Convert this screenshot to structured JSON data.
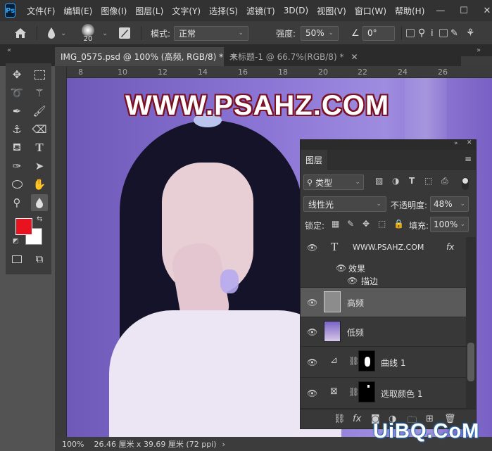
{
  "app": {
    "logo": "Ps"
  },
  "menu": [
    "文件(F)",
    "编辑(E)",
    "图像(I)",
    "图层(L)",
    "文字(Y)",
    "选择(S)",
    "滤镜(T)",
    "3D(D)",
    "视图(V)",
    "窗口(W)",
    "帮助(H)"
  ],
  "window_controls": {
    "minimize": "—",
    "maximize": "☐",
    "close": "✕"
  },
  "options": {
    "brush_size": "20",
    "mode_label": "模式:",
    "mode_value": "正常",
    "strength_label": "强度:",
    "strength_value": "50%",
    "angle_value": "0°"
  },
  "tabs": [
    {
      "label": "IMG_0575.psd @ 100% (高频, RGB/8) *",
      "close": "✕"
    },
    {
      "label": "未标题-1 @ 66.7%(RGB/8) *",
      "close": "✕"
    }
  ],
  "ruler_h": [
    "8",
    "10",
    "12",
    "14",
    "16",
    "18",
    "20",
    "22",
    "24",
    "26"
  ],
  "canvas": {
    "watermark": "WWW.PSAHZ.COM"
  },
  "status": {
    "zoom": "100%",
    "doc_info": "26.46 厘米 x 39.69 厘米 (72 ppi)",
    "arrow": "›"
  },
  "site_watermark": "UiBQ.CoM",
  "layers_panel": {
    "title": "图层",
    "filter_label": "类型",
    "blend_mode": "线性光",
    "opacity_label": "不透明度:",
    "opacity_value": "48%",
    "lock_label": "锁定:",
    "fill_label": "填充:",
    "fill_value": "100%",
    "layers": [
      {
        "name": "WWW.PSAHZ.COM",
        "fx": "fx",
        "effects_label": "效果",
        "stroke_label": "描边"
      },
      {
        "name": "高频",
        "selected": true
      },
      {
        "name": "低频"
      },
      {
        "name": "曲线",
        "num": "1"
      },
      {
        "name": "选取颜色",
        "num": "1"
      }
    ]
  },
  "colors": {
    "foreground": "#e8131f",
    "background": "#ffffff",
    "accent": "#31a8ff"
  }
}
